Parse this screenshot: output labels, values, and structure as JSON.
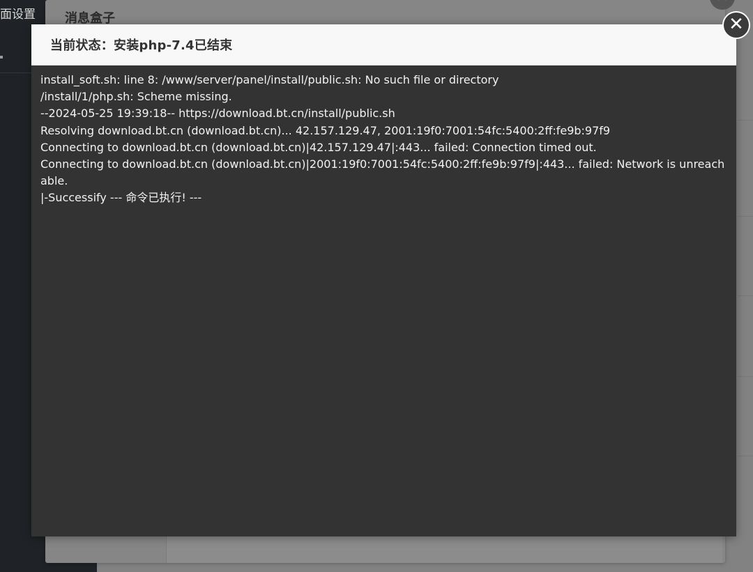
{
  "background": {
    "sidebar_label": "面设置",
    "dialog_title": "消息盒子"
  },
  "modal": {
    "title": "当前状态：安装php-7.4已结束",
    "close_icon": "close-icon",
    "log_lines": [
      "install_soft.sh: line 8: /www/server/panel/install/public.sh: No such file or directory",
      "/install/1/php.sh: Scheme missing.",
      "--2024-05-25 19:39:18-- https://download.bt.cn/install/public.sh",
      "Resolving download.bt.cn (download.bt.cn)... 42.157.129.47, 2001:19f0:7001:54fc:5400:2ff:fe9b:97f9",
      "Connecting to download.bt.cn (download.bt.cn)|42.157.129.47|:443... failed: Connection timed out.",
      "Connecting to download.bt.cn (download.bt.cn)|2001:19f0:7001:54fc:5400:2ff:fe9b:97f9|:443... failed: Network is unreachable.",
      "|-Successify --- 命令已执行! ---"
    ]
  },
  "colors": {
    "modal_body_bg": "#333333",
    "modal_header_bg": "#f8f8f8",
    "overlay_bg": "#7a7a7a",
    "sidebar_bg": "#1f2226"
  }
}
